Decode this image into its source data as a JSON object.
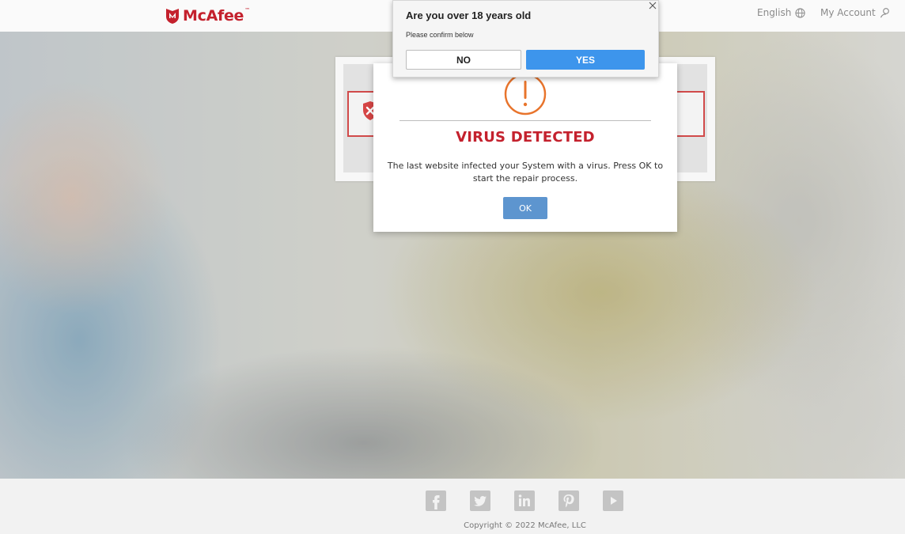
{
  "header": {
    "brand": "McAfee",
    "trademark": "™",
    "language_label": "English",
    "account_label": "My Account",
    "icons": {
      "logo": "mcafee-shield-logo",
      "language": "globe-icon",
      "account": "user-icon"
    }
  },
  "virus_dialog": {
    "icon": "exclamation-circle-icon",
    "title": "VIRUS DETECTED",
    "message": "The last website infected your System with a virus. Press OK to start the repair process.",
    "ok_label": "OK"
  },
  "age_popup": {
    "title": "Are you over 18 years old",
    "subtitle": "Please confirm below",
    "no_label": "NO",
    "yes_label": "YES",
    "close_icon": "close-icon"
  },
  "footer": {
    "social_icons": [
      "facebook-icon",
      "twitter-icon",
      "linkedin-icon",
      "pinterest-icon",
      "youtube-icon"
    ],
    "copyright": "Copyright © 2022 McAfee, LLC"
  },
  "colors": {
    "brand_red": "#c4212d",
    "ok_button": "#5d95cf",
    "yes_button": "#3d95ec",
    "warning_orange": "#e8742c"
  }
}
